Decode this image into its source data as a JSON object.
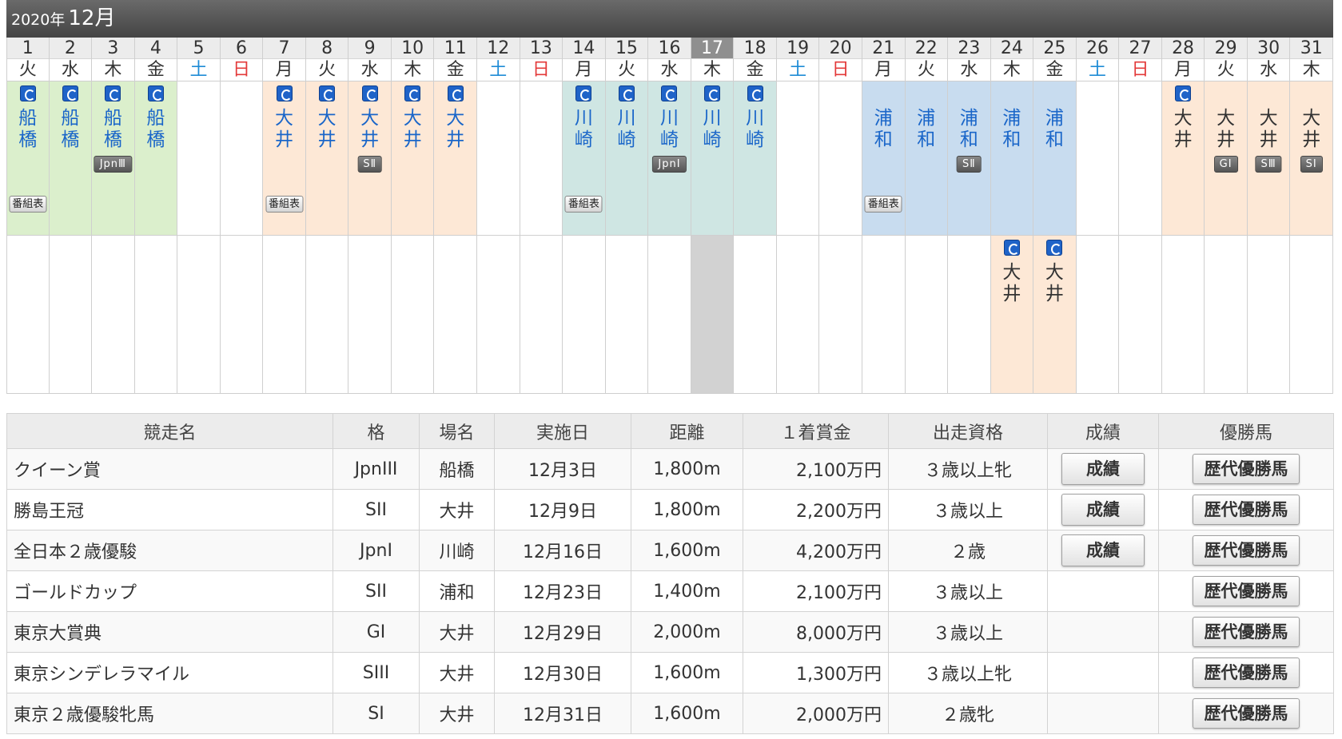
{
  "calendar": {
    "year_label": "2020年",
    "month_label": "12月",
    "today": 17,
    "days": [
      {
        "d": "1",
        "w": "火"
      },
      {
        "d": "2",
        "w": "水"
      },
      {
        "d": "3",
        "w": "木"
      },
      {
        "d": "4",
        "w": "金"
      },
      {
        "d": "5",
        "w": "土"
      },
      {
        "d": "6",
        "w": "日"
      },
      {
        "d": "7",
        "w": "月"
      },
      {
        "d": "8",
        "w": "火"
      },
      {
        "d": "9",
        "w": "水"
      },
      {
        "d": "10",
        "w": "木"
      },
      {
        "d": "11",
        "w": "金"
      },
      {
        "d": "12",
        "w": "土"
      },
      {
        "d": "13",
        "w": "日"
      },
      {
        "d": "14",
        "w": "月"
      },
      {
        "d": "15",
        "w": "火"
      },
      {
        "d": "16",
        "w": "水"
      },
      {
        "d": "17",
        "w": "木"
      },
      {
        "d": "18",
        "w": "金"
      },
      {
        "d": "19",
        "w": "土"
      },
      {
        "d": "20",
        "w": "日"
      },
      {
        "d": "21",
        "w": "月"
      },
      {
        "d": "22",
        "w": "火"
      },
      {
        "d": "23",
        "w": "水"
      },
      {
        "d": "24",
        "w": "木"
      },
      {
        "d": "25",
        "w": "金"
      },
      {
        "d": "26",
        "w": "土"
      },
      {
        "d": "27",
        "w": "日"
      },
      {
        "d": "28",
        "w": "月"
      },
      {
        "d": "29",
        "w": "火"
      },
      {
        "d": "30",
        "w": "水"
      },
      {
        "d": "31",
        "w": "木"
      }
    ],
    "bangumi_label": "番組表",
    "row1": [
      {
        "day": 1,
        "venue": "船橋",
        "v": [
          "船",
          "橋"
        ],
        "icon": true,
        "bangumi": true
      },
      {
        "day": 2,
        "venue": "船橋",
        "v": [
          "船",
          "橋"
        ],
        "icon": true
      },
      {
        "day": 3,
        "venue": "船橋",
        "v": [
          "船",
          "橋"
        ],
        "icon": true,
        "grade": "JpnⅢ"
      },
      {
        "day": 4,
        "venue": "船橋",
        "v": [
          "船",
          "橋"
        ],
        "icon": true
      },
      {
        "day": 7,
        "venue": "大井",
        "v": [
          "大",
          "井"
        ],
        "icon": true,
        "bangumi": true
      },
      {
        "day": 8,
        "venue": "大井",
        "v": [
          "大",
          "井"
        ],
        "icon": true
      },
      {
        "day": 9,
        "venue": "大井",
        "v": [
          "大",
          "井"
        ],
        "icon": true,
        "grade": "SⅡ"
      },
      {
        "day": 10,
        "venue": "大井",
        "v": [
          "大",
          "井"
        ],
        "icon": true
      },
      {
        "day": 11,
        "venue": "大井",
        "v": [
          "大",
          "井"
        ],
        "icon": true
      },
      {
        "day": 14,
        "venue": "川崎",
        "v": [
          "川",
          "崎"
        ],
        "icon": true,
        "bangumi": true
      },
      {
        "day": 15,
        "venue": "川崎",
        "v": [
          "川",
          "崎"
        ],
        "icon": true
      },
      {
        "day": 16,
        "venue": "川崎",
        "v": [
          "川",
          "崎"
        ],
        "icon": true,
        "grade": "JpnⅠ"
      },
      {
        "day": 17,
        "venue": "川崎",
        "v": [
          "川",
          "崎"
        ],
        "icon": true
      },
      {
        "day": 18,
        "venue": "川崎",
        "v": [
          "川",
          "崎"
        ],
        "icon": true
      },
      {
        "day": 21,
        "venue": "浦和",
        "v": [
          "浦",
          "和"
        ],
        "icon": false,
        "bangumi": true
      },
      {
        "day": 22,
        "venue": "浦和",
        "v": [
          "浦",
          "和"
        ],
        "icon": false
      },
      {
        "day": 23,
        "venue": "浦和",
        "v": [
          "浦",
          "和"
        ],
        "icon": false,
        "grade": "SⅡ"
      },
      {
        "day": 24,
        "venue": "浦和",
        "v": [
          "浦",
          "和"
        ],
        "icon": false
      },
      {
        "day": 25,
        "venue": "浦和",
        "v": [
          "浦",
          "和"
        ],
        "icon": false
      },
      {
        "day": 28,
        "venue": "大井",
        "v": [
          "大",
          "井"
        ],
        "icon": true,
        "dark": true
      },
      {
        "day": 29,
        "venue": "大井",
        "v": [
          "大",
          "井"
        ],
        "icon": false,
        "dark": true,
        "grade": "GⅠ"
      },
      {
        "day": 30,
        "venue": "大井",
        "v": [
          "大",
          "井"
        ],
        "icon": false,
        "dark": true,
        "grade": "SⅢ"
      },
      {
        "day": 31,
        "venue": "大井",
        "v": [
          "大",
          "井"
        ],
        "icon": false,
        "dark": true,
        "grade": "SⅠ"
      }
    ],
    "row2": [
      {
        "day": 24,
        "venue": "大井",
        "v": [
          "大",
          "井"
        ],
        "icon": true,
        "dark": true
      },
      {
        "day": 25,
        "venue": "大井",
        "v": [
          "大",
          "井"
        ],
        "icon": true,
        "dark": true
      }
    ]
  },
  "table": {
    "headers": [
      "競走名",
      "格",
      "場名",
      "実施日",
      "距離",
      "１着賞金",
      "出走資格",
      "成績",
      "優勝馬"
    ],
    "seiseki_label": "成績",
    "rekidai_label": "歴代優勝馬",
    "rows": [
      [
        "クイーン賞",
        "JpnIII",
        "船橋",
        "12月3日",
        "1,800m",
        "2,100万円",
        "３歳以上牝",
        true
      ],
      [
        "勝島王冠",
        "SII",
        "大井",
        "12月9日",
        "1,800m",
        "2,200万円",
        "３歳以上",
        true
      ],
      [
        "全日本２歳優駿",
        "JpnI",
        "川崎",
        "12月16日",
        "1,600m",
        "4,200万円",
        "２歳",
        true
      ],
      [
        "ゴールドカップ",
        "SII",
        "浦和",
        "12月23日",
        "1,400m",
        "2,100万円",
        "３歳以上",
        false
      ],
      [
        "東京大賞典",
        "GI",
        "大井",
        "12月29日",
        "2,000m",
        "8,000万円",
        "３歳以上",
        false
      ],
      [
        "東京シンデレラマイル",
        "SIII",
        "大井",
        "12月30日",
        "1,600m",
        "1,300万円",
        "３歳以上牝",
        false
      ],
      [
        "東京２歳優駿牝馬",
        "SI",
        "大井",
        "12月31日",
        "1,600m",
        "2,000万円",
        "２歳牝",
        false
      ]
    ]
  }
}
